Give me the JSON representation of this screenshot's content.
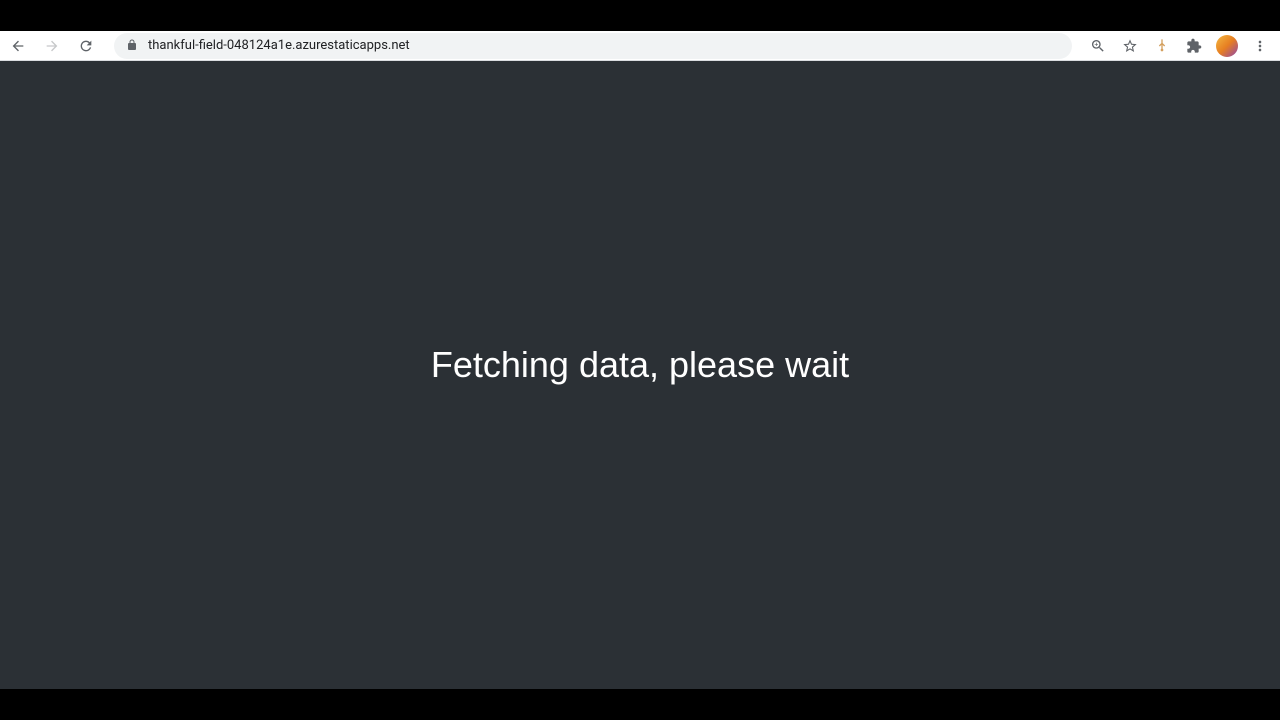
{
  "browser": {
    "url": "thankful-field-048124a1e.azurestaticapps.net"
  },
  "page": {
    "loading_message": "Fetching data, please wait"
  }
}
